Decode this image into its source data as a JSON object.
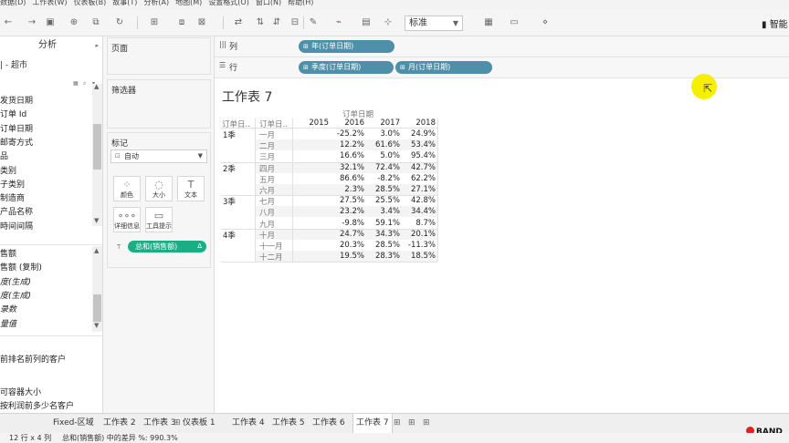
{
  "menu": [
    "数据(D)",
    "工作表(W)",
    "仪表板(B)",
    "故事(T)",
    "分析(A)",
    "地图(M)",
    "设置格式(O)",
    "窗口(N)",
    "帮助(H)"
  ],
  "toolbar": {
    "fit_value": "标准",
    "smart_label": "智能"
  },
  "data_pane": {
    "tab_analysis": "分析",
    "datasource": "| - 超市",
    "fields_dimensions": [
      "发货日期",
      "订单 Id",
      "订单日期",
      "邮寄方式",
      "品",
      "类别",
      "子类别",
      "制造商",
      "产品名称",
      "時间间隔"
    ],
    "fields_measures": [
      {
        "label": "售额",
        "italic": false
      },
      {
        "label": "售额 (复制)",
        "italic": false
      },
      {
        "label": "度(生成)",
        "italic": true
      },
      {
        "label": "度(生成)",
        "italic": true
      },
      {
        "label": "录数",
        "italic": true
      },
      {
        "label": "量值",
        "italic": true
      }
    ],
    "params": [
      "前排名前列的客户",
      "可容器大小",
      "按利润前多少名客户"
    ]
  },
  "shelves": {
    "pages_label": "页面",
    "filters_label": "筛选器",
    "marks_label": "标记",
    "marks_type": "自动",
    "mark_buttons": [
      "颜色",
      "大小",
      "文本",
      "详细信息",
      "工具提示"
    ],
    "marks_pill": "总和(销售额)",
    "marks_pill_delta": "Δ",
    "columns_label": "列",
    "rows_label": "行",
    "columns_pills": [
      "年(订单日期)"
    ],
    "rows_pills": [
      "季度(订单日期)",
      "月(订单日期)"
    ]
  },
  "viz": {
    "title": "工作表 7",
    "header_top": "订单日期",
    "row_headers": [
      "订单日..",
      "订单日.."
    ],
    "years": [
      "2015",
      "2016",
      "2017",
      "2018"
    ],
    "quarters": [
      "1季",
      "2季",
      "3季",
      "4季"
    ],
    "months": [
      "一月",
      "二月",
      "三月",
      "四月",
      "五月",
      "六月",
      "七月",
      "八月",
      "九月",
      "十月",
      "十一月",
      "十二月"
    ],
    "cells": [
      [
        "",
        "-25.2%",
        "3.0%",
        "24.9%"
      ],
      [
        "",
        "12.2%",
        "61.6%",
        "53.4%"
      ],
      [
        "",
        "16.6%",
        "5.0%",
        "95.4%"
      ],
      [
        "",
        "32.1%",
        "72.4%",
        "42.7%"
      ],
      [
        "",
        "86.6%",
        "-8.2%",
        "62.2%"
      ],
      [
        "",
        "2.3%",
        "28.5%",
        "27.1%"
      ],
      [
        "",
        "27.5%",
        "25.5%",
        "42.8%"
      ],
      [
        "",
        "23.2%",
        "3.4%",
        "34.4%"
      ],
      [
        "",
        "-9.8%",
        "59.1%",
        "8.7%"
      ],
      [
        "",
        "24.7%",
        "34.3%",
        "20.1%"
      ],
      [
        "",
        "20.3%",
        "28.5%",
        "-11.3%"
      ],
      [
        "",
        "19.5%",
        "28.3%",
        "18.5%"
      ]
    ]
  },
  "tabs": [
    "Fixed-区域",
    "工作表 2",
    "工作表 3",
    "仪表板 1",
    "工作表 4",
    "工作表 5",
    "工作表 6",
    "工作表 7"
  ],
  "active_tab": "工作表 7",
  "logo_text": "BAND",
  "status": {
    "dims": "12 行 x 4 列",
    "summary": "总和(销售额) 中的差异 %: 990.3%"
  }
}
